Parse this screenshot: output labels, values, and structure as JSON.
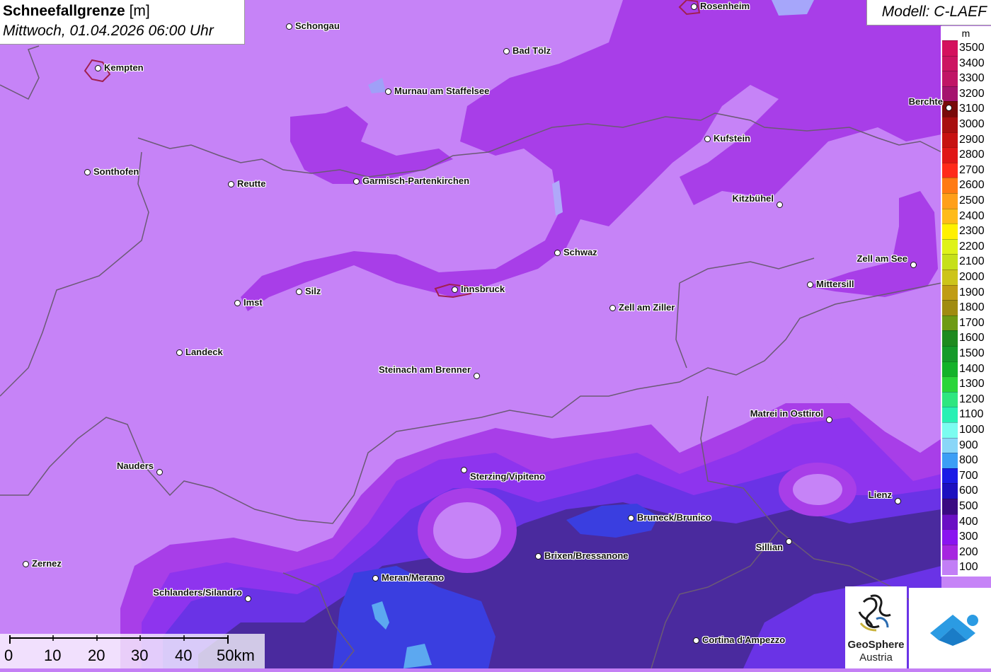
{
  "header": {
    "title_bold": "Schneefallgrenze",
    "title_unit": "[m]",
    "datetime": "Mittwoch, 01.04.2026 06:00 Uhr"
  },
  "model": "Modell: C-LAEF",
  "legend": {
    "unit": "m",
    "items": [
      {
        "label": "3500",
        "color": "#d4115e"
      },
      {
        "label": "3400",
        "color": "#cc1462"
      },
      {
        "label": "3300",
        "color": "#c01566"
      },
      {
        "label": "3200",
        "color": "#a5136e"
      },
      {
        "label": "3100",
        "color": "#7a0a0a"
      },
      {
        "label": "3000",
        "color": "#a80f0f"
      },
      {
        "label": "2900",
        "color": "#c71111"
      },
      {
        "label": "2800",
        "color": "#e01616"
      },
      {
        "label": "2700",
        "color": "#ff2a1a"
      },
      {
        "label": "2600",
        "color": "#ff7a14"
      },
      {
        "label": "2500",
        "color": "#ff9f1a"
      },
      {
        "label": "2400",
        "color": "#ffbb1a"
      },
      {
        "label": "2300",
        "color": "#fff000"
      },
      {
        "label": "2200",
        "color": "#dff21a"
      },
      {
        "label": "2100",
        "color": "#c6e01a"
      },
      {
        "label": "2000",
        "color": "#cdc41a"
      },
      {
        "label": "1900",
        "color": "#c09c14"
      },
      {
        "label": "1800",
        "color": "#a08b10"
      },
      {
        "label": "1700",
        "color": "#6e9a14"
      },
      {
        "label": "1600",
        "color": "#1f8a1f"
      },
      {
        "label": "1500",
        "color": "#169a2a"
      },
      {
        "label": "1400",
        "color": "#14b22a"
      },
      {
        "label": "1300",
        "color": "#2ad53a"
      },
      {
        "label": "1200",
        "color": "#2ee680"
      },
      {
        "label": "1100",
        "color": "#28f0b4"
      },
      {
        "label": "1000",
        "color": "#7bfcf0"
      },
      {
        "label": "900",
        "color": "#8ad6f8"
      },
      {
        "label": "800",
        "color": "#3c9ef5"
      },
      {
        "label": "700",
        "color": "#1a1ae6"
      },
      {
        "label": "600",
        "color": "#1c0fbf"
      },
      {
        "label": "500",
        "color": "#3a0a82"
      },
      {
        "label": "400",
        "color": "#6a0fc4"
      },
      {
        "label": "300",
        "color": "#8a14f0"
      },
      {
        "label": "200",
        "color": "#a626e0"
      },
      {
        "label": "100",
        "color": "#c27ef6"
      }
    ]
  },
  "scale": {
    "ticks": [
      "0",
      "10",
      "20",
      "30",
      "40",
      "50km"
    ]
  },
  "logo": {
    "name_line1": "GeoSphere",
    "name_line2": "Austria"
  },
  "cities": [
    {
      "name": "Rosenheim"
    },
    {
      "name": "Schongau"
    },
    {
      "name": "Kempten"
    },
    {
      "name": "Bad Tölz"
    },
    {
      "name": "Murnau am Staffelsee"
    },
    {
      "name": "Berchte"
    },
    {
      "name": "Kufstein"
    },
    {
      "name": "Sonthofen"
    },
    {
      "name": "Reutte"
    },
    {
      "name": "Garmisch-Partenkirchen"
    },
    {
      "name": "Kitzbühel"
    },
    {
      "name": "Schwaz"
    },
    {
      "name": "Zell am See"
    },
    {
      "name": "Mittersill"
    },
    {
      "name": "Imst"
    },
    {
      "name": "Silz"
    },
    {
      "name": "Innsbruck"
    },
    {
      "name": "Zell am Ziller"
    },
    {
      "name": "Landeck"
    },
    {
      "name": "Steinach am Brenner"
    },
    {
      "name": "Matrei in Osttirol"
    },
    {
      "name": "Nauders"
    },
    {
      "name": "Sterzing/Vipiteno"
    },
    {
      "name": "Lienz"
    },
    {
      "name": "Bruneck/Brunico"
    },
    {
      "name": "Sillian"
    },
    {
      "name": "Brixen/Bressanone"
    },
    {
      "name": "Zernez"
    },
    {
      "name": "Schlanders/Silandro"
    },
    {
      "name": "Meran/Merano"
    },
    {
      "name": "Cortina d'Ampezzo"
    }
  ]
}
